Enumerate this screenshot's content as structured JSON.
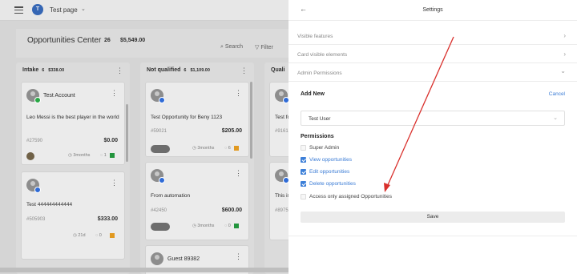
{
  "app": {
    "page_avatar_letter": "T",
    "page_title": "Test page",
    "title": "Opportunities Center",
    "total_count": "26",
    "total_amount": "$5,549.00",
    "search_label": "Search",
    "filter_label": "Filter"
  },
  "columns": [
    {
      "name": "Intake",
      "count": "6",
      "amount": "$338.00",
      "cards": [
        {
          "name": "Test Account",
          "title": "Leo Messi is the best player in the world",
          "id": "#27590",
          "amount": "$0.00",
          "time": "3months",
          "comments": "1"
        },
        {
          "name": "",
          "title": "Test 444444444444",
          "id": "#505903",
          "amount": "$333.00",
          "time": "21d",
          "comments": "0"
        }
      ]
    },
    {
      "name": "Not qualified",
      "count": "6",
      "amount": "$1,109.00",
      "cards": [
        {
          "name": "",
          "title": "Test Opportunity for Beny 1123",
          "id": "#59021",
          "amount": "$205.00",
          "time": "3months",
          "comments": "6"
        },
        {
          "name": "",
          "title": "From automation",
          "id": "#42450",
          "amount": "$600.00",
          "time": "3months",
          "comments": "0"
        },
        {
          "name": "Guest 89382",
          "title": "",
          "id": "",
          "amount": "",
          "time": "",
          "comments": ""
        }
      ]
    },
    {
      "name": "Quali",
      "cards": [
        {
          "title": "Test fo",
          "id": "#9161"
        },
        {
          "title": "This is",
          "id": "#8975"
        }
      ]
    }
  ],
  "settings": {
    "title": "Settings",
    "sections": [
      {
        "label": "Visible features",
        "chevron": "›"
      },
      {
        "label": "Card visible elements",
        "chevron": "›"
      },
      {
        "label": "Admin Permissions",
        "chevron": "⌄"
      }
    ],
    "add_new_label": "Add New",
    "cancel_label": "Cancel",
    "selected_user": "Test User",
    "permissions_label": "Permissions",
    "permissions": [
      {
        "label": "Super Admin",
        "checked": false
      },
      {
        "label": "View opportunities",
        "checked": true
      },
      {
        "label": "Edit opportunities",
        "checked": true
      },
      {
        "label": "Delete opportunities",
        "checked": true
      },
      {
        "label": "Access only assigned Opportunities",
        "checked": false
      }
    ],
    "save_label": "Save"
  },
  "colors": {
    "accent": "#3c7fd8",
    "annotation_arrow": "#d9302c"
  }
}
